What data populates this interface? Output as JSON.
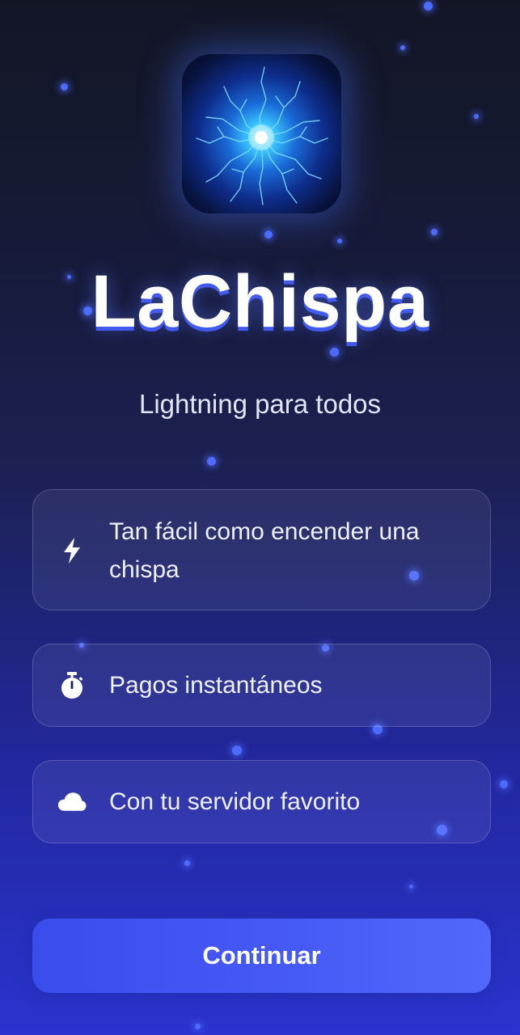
{
  "app": {
    "name": "LaChispa",
    "tagline": "Lightning para todos"
  },
  "features": [
    {
      "icon": "lightning-bolt-icon",
      "label": "Tan fácil como encender una chispa"
    },
    {
      "icon": "stopwatch-icon",
      "label": "Pagos instantáneos"
    },
    {
      "icon": "cloud-icon",
      "label": "Con tu servidor favorito"
    }
  ],
  "actions": {
    "continue_label": "Continuar"
  },
  "colors": {
    "background_top": "#121624",
    "background_bottom": "#2a33cf",
    "accent": "#4659f5",
    "particle": "#4d6bff"
  }
}
